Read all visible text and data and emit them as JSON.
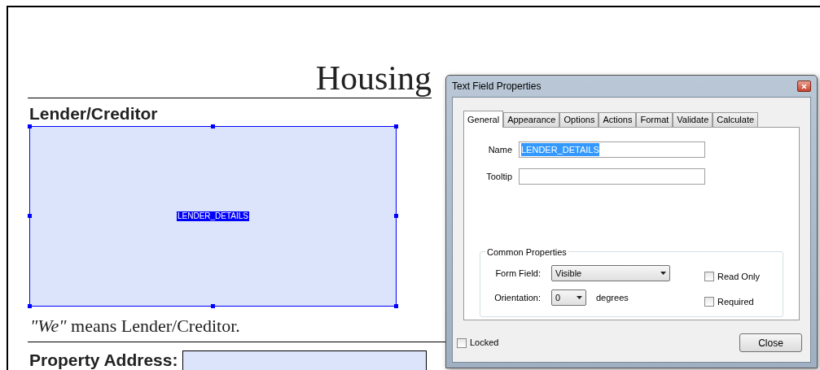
{
  "document": {
    "title": "Housing",
    "section_heading": "Lender/Creditor",
    "form_field_label": "LENDER_DETAILS",
    "definition": "*\"We\"* means Lender/Creditor.",
    "next_heading": "Property Address:"
  },
  "dialog": {
    "title": "Text Field Properties",
    "tabs": [
      {
        "label": "General",
        "selected": true
      },
      {
        "label": "Appearance",
        "selected": false
      },
      {
        "label": "Options",
        "selected": false
      },
      {
        "label": "Actions",
        "selected": false
      },
      {
        "label": "Format",
        "selected": false
      },
      {
        "label": "Validate",
        "selected": false
      },
      {
        "label": "Calculate",
        "selected": false
      }
    ],
    "name": {
      "label": "Name",
      "value": "LENDER_DETAILS"
    },
    "tooltip": {
      "label": "Tooltip"
    },
    "group": {
      "title": "Common Properties",
      "form_field": {
        "label": "Form Field:",
        "value": "Visible"
      },
      "orientation": {
        "label": "Orientation:",
        "value": "0",
        "unit": "degrees"
      },
      "checkboxes": [
        {
          "label": "Read Only",
          "checked": false
        },
        {
          "label": "Required",
          "checked": false
        }
      ]
    },
    "locked": {
      "label": "Locked",
      "checked": false
    },
    "close_button": "Close"
  }
}
